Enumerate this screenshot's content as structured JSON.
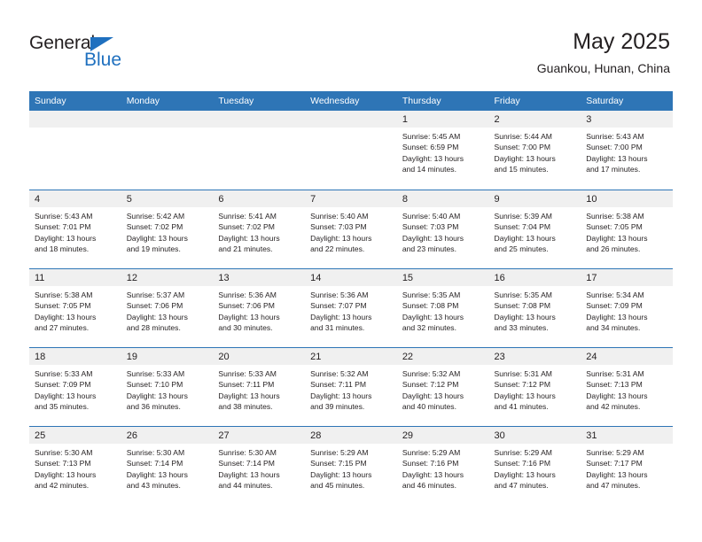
{
  "brand": {
    "name_part1": "General",
    "name_part2": "Blue",
    "accent_color": "#1f70bf",
    "triangle_icon": "triangle-icon"
  },
  "header": {
    "title": "May 2025",
    "subtitle": "Guankou, Hunan, China"
  },
  "calendar": {
    "header_bg": "#2e75b6",
    "day_band_bg": "#f0f0f0",
    "day_names": [
      "Sunday",
      "Monday",
      "Tuesday",
      "Wednesday",
      "Thursday",
      "Friday",
      "Saturday"
    ],
    "weeks": [
      [
        {
          "day": "",
          "empty": true
        },
        {
          "day": "",
          "empty": true
        },
        {
          "day": "",
          "empty": true
        },
        {
          "day": "",
          "empty": true
        },
        {
          "day": "1",
          "sunrise": "Sunrise: 5:45 AM",
          "sunset": "Sunset: 6:59 PM",
          "daylight_1": "Daylight: 13 hours",
          "daylight_2": "and 14 minutes."
        },
        {
          "day": "2",
          "sunrise": "Sunrise: 5:44 AM",
          "sunset": "Sunset: 7:00 PM",
          "daylight_1": "Daylight: 13 hours",
          "daylight_2": "and 15 minutes."
        },
        {
          "day": "3",
          "sunrise": "Sunrise: 5:43 AM",
          "sunset": "Sunset: 7:00 PM",
          "daylight_1": "Daylight: 13 hours",
          "daylight_2": "and 17 minutes."
        }
      ],
      [
        {
          "day": "4",
          "sunrise": "Sunrise: 5:43 AM",
          "sunset": "Sunset: 7:01 PM",
          "daylight_1": "Daylight: 13 hours",
          "daylight_2": "and 18 minutes."
        },
        {
          "day": "5",
          "sunrise": "Sunrise: 5:42 AM",
          "sunset": "Sunset: 7:02 PM",
          "daylight_1": "Daylight: 13 hours",
          "daylight_2": "and 19 minutes."
        },
        {
          "day": "6",
          "sunrise": "Sunrise: 5:41 AM",
          "sunset": "Sunset: 7:02 PM",
          "daylight_1": "Daylight: 13 hours",
          "daylight_2": "and 21 minutes."
        },
        {
          "day": "7",
          "sunrise": "Sunrise: 5:40 AM",
          "sunset": "Sunset: 7:03 PM",
          "daylight_1": "Daylight: 13 hours",
          "daylight_2": "and 22 minutes."
        },
        {
          "day": "8",
          "sunrise": "Sunrise: 5:40 AM",
          "sunset": "Sunset: 7:03 PM",
          "daylight_1": "Daylight: 13 hours",
          "daylight_2": "and 23 minutes."
        },
        {
          "day": "9",
          "sunrise": "Sunrise: 5:39 AM",
          "sunset": "Sunset: 7:04 PM",
          "daylight_1": "Daylight: 13 hours",
          "daylight_2": "and 25 minutes."
        },
        {
          "day": "10",
          "sunrise": "Sunrise: 5:38 AM",
          "sunset": "Sunset: 7:05 PM",
          "daylight_1": "Daylight: 13 hours",
          "daylight_2": "and 26 minutes."
        }
      ],
      [
        {
          "day": "11",
          "sunrise": "Sunrise: 5:38 AM",
          "sunset": "Sunset: 7:05 PM",
          "daylight_1": "Daylight: 13 hours",
          "daylight_2": "and 27 minutes."
        },
        {
          "day": "12",
          "sunrise": "Sunrise: 5:37 AM",
          "sunset": "Sunset: 7:06 PM",
          "daylight_1": "Daylight: 13 hours",
          "daylight_2": "and 28 minutes."
        },
        {
          "day": "13",
          "sunrise": "Sunrise: 5:36 AM",
          "sunset": "Sunset: 7:06 PM",
          "daylight_1": "Daylight: 13 hours",
          "daylight_2": "and 30 minutes."
        },
        {
          "day": "14",
          "sunrise": "Sunrise: 5:36 AM",
          "sunset": "Sunset: 7:07 PM",
          "daylight_1": "Daylight: 13 hours",
          "daylight_2": "and 31 minutes."
        },
        {
          "day": "15",
          "sunrise": "Sunrise: 5:35 AM",
          "sunset": "Sunset: 7:08 PM",
          "daylight_1": "Daylight: 13 hours",
          "daylight_2": "and 32 minutes."
        },
        {
          "day": "16",
          "sunrise": "Sunrise: 5:35 AM",
          "sunset": "Sunset: 7:08 PM",
          "daylight_1": "Daylight: 13 hours",
          "daylight_2": "and 33 minutes."
        },
        {
          "day": "17",
          "sunrise": "Sunrise: 5:34 AM",
          "sunset": "Sunset: 7:09 PM",
          "daylight_1": "Daylight: 13 hours",
          "daylight_2": "and 34 minutes."
        }
      ],
      [
        {
          "day": "18",
          "sunrise": "Sunrise: 5:33 AM",
          "sunset": "Sunset: 7:09 PM",
          "daylight_1": "Daylight: 13 hours",
          "daylight_2": "and 35 minutes."
        },
        {
          "day": "19",
          "sunrise": "Sunrise: 5:33 AM",
          "sunset": "Sunset: 7:10 PM",
          "daylight_1": "Daylight: 13 hours",
          "daylight_2": "and 36 minutes."
        },
        {
          "day": "20",
          "sunrise": "Sunrise: 5:33 AM",
          "sunset": "Sunset: 7:11 PM",
          "daylight_1": "Daylight: 13 hours",
          "daylight_2": "and 38 minutes."
        },
        {
          "day": "21",
          "sunrise": "Sunrise: 5:32 AM",
          "sunset": "Sunset: 7:11 PM",
          "daylight_1": "Daylight: 13 hours",
          "daylight_2": "and 39 minutes."
        },
        {
          "day": "22",
          "sunrise": "Sunrise: 5:32 AM",
          "sunset": "Sunset: 7:12 PM",
          "daylight_1": "Daylight: 13 hours",
          "daylight_2": "and 40 minutes."
        },
        {
          "day": "23",
          "sunrise": "Sunrise: 5:31 AM",
          "sunset": "Sunset: 7:12 PM",
          "daylight_1": "Daylight: 13 hours",
          "daylight_2": "and 41 minutes."
        },
        {
          "day": "24",
          "sunrise": "Sunrise: 5:31 AM",
          "sunset": "Sunset: 7:13 PM",
          "daylight_1": "Daylight: 13 hours",
          "daylight_2": "and 42 minutes."
        }
      ],
      [
        {
          "day": "25",
          "sunrise": "Sunrise: 5:30 AM",
          "sunset": "Sunset: 7:13 PM",
          "daylight_1": "Daylight: 13 hours",
          "daylight_2": "and 42 minutes."
        },
        {
          "day": "26",
          "sunrise": "Sunrise: 5:30 AM",
          "sunset": "Sunset: 7:14 PM",
          "daylight_1": "Daylight: 13 hours",
          "daylight_2": "and 43 minutes."
        },
        {
          "day": "27",
          "sunrise": "Sunrise: 5:30 AM",
          "sunset": "Sunset: 7:14 PM",
          "daylight_1": "Daylight: 13 hours",
          "daylight_2": "and 44 minutes."
        },
        {
          "day": "28",
          "sunrise": "Sunrise: 5:29 AM",
          "sunset": "Sunset: 7:15 PM",
          "daylight_1": "Daylight: 13 hours",
          "daylight_2": "and 45 minutes."
        },
        {
          "day": "29",
          "sunrise": "Sunrise: 5:29 AM",
          "sunset": "Sunset: 7:16 PM",
          "daylight_1": "Daylight: 13 hours",
          "daylight_2": "and 46 minutes."
        },
        {
          "day": "30",
          "sunrise": "Sunrise: 5:29 AM",
          "sunset": "Sunset: 7:16 PM",
          "daylight_1": "Daylight: 13 hours",
          "daylight_2": "and 47 minutes."
        },
        {
          "day": "31",
          "sunrise": "Sunrise: 5:29 AM",
          "sunset": "Sunset: 7:17 PM",
          "daylight_1": "Daylight: 13 hours",
          "daylight_2": "and 47 minutes."
        }
      ]
    ]
  }
}
